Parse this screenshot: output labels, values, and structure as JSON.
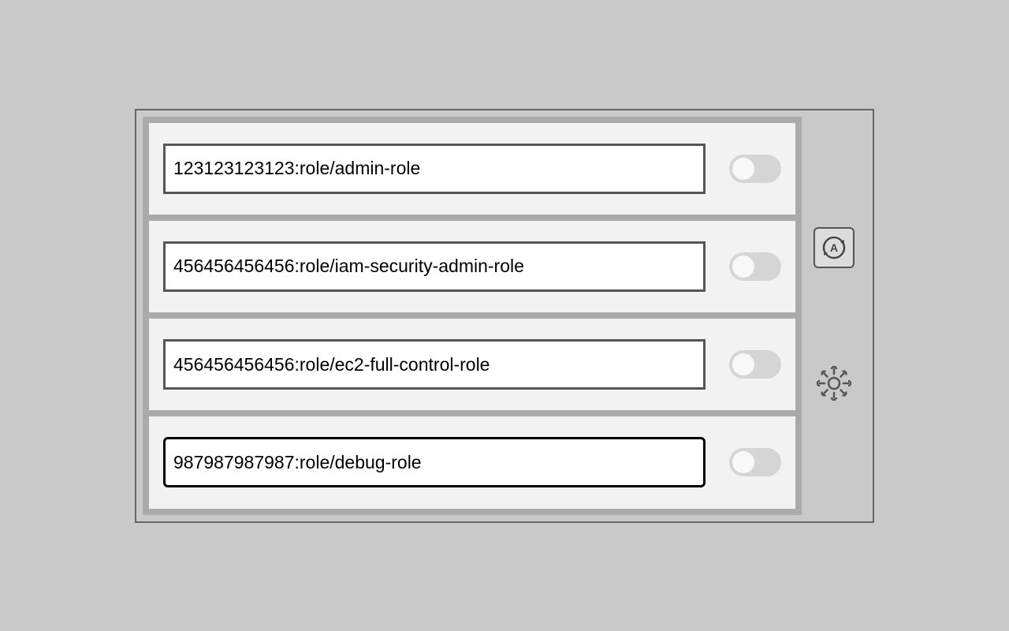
{
  "roles": {
    "items": [
      {
        "value": "123123123123:role/admin-role",
        "toggled": false,
        "active": false
      },
      {
        "value": "456456456456:role/iam-security-admin-role",
        "toggled": false,
        "active": false
      },
      {
        "value": "456456456456:role/ec2-full-control-role",
        "toggled": false,
        "active": false
      },
      {
        "value": "987987987987:role/debug-role",
        "toggled": false,
        "active": true
      }
    ]
  },
  "colors": {
    "panel_bg": "#c9c9c9",
    "row_bg": "#f2f2f2",
    "inputs_container_bg": "#aaaaaa",
    "toggle_track": "#d5d5d5",
    "toggle_knob": "#f8f8f8"
  }
}
